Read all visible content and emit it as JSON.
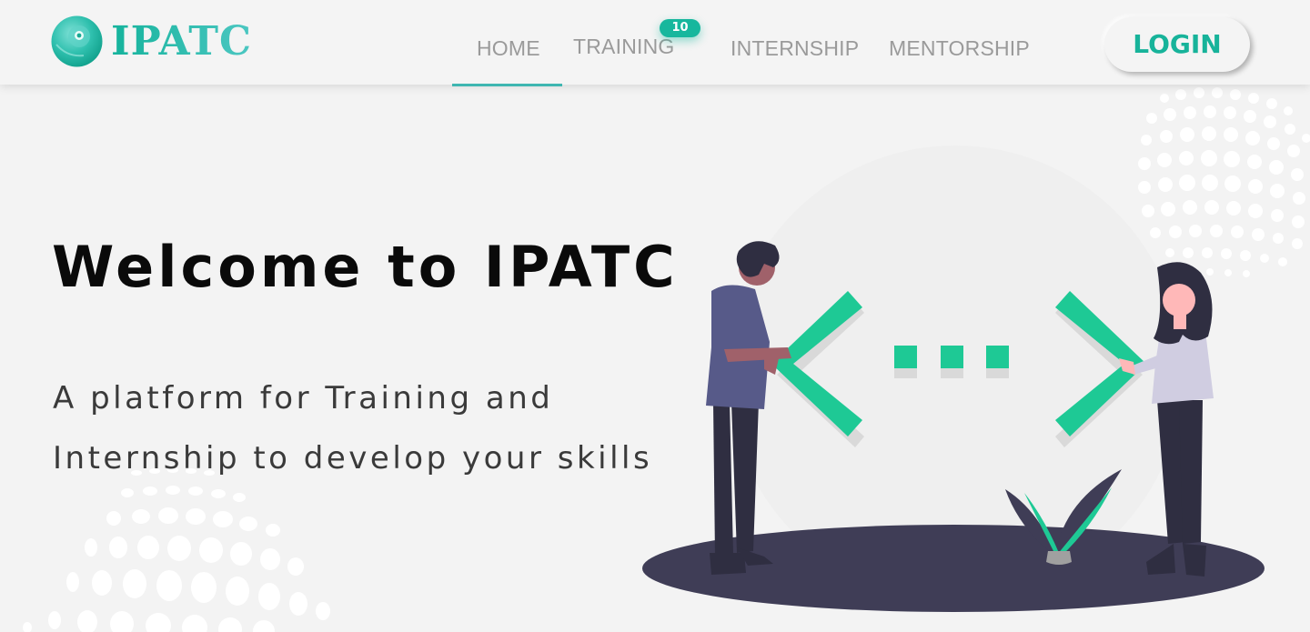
{
  "header": {
    "logo_text": "IPATC",
    "nav": {
      "home": "HOME",
      "training": "TRAINING",
      "internship": "INTERNSHIP",
      "mentorship": "MENTORSHIP"
    },
    "training_badge": "10",
    "active_nav": "HOME",
    "login_label": "LOGIN"
  },
  "hero": {
    "title": "Welcome to IPATC",
    "subtitle_line1": "A platform for Training and",
    "subtitle_line2": "Internship to develop your skills"
  },
  "colors": {
    "accent": "#17b79d",
    "brand_gradient_start": "#15b39c",
    "brand_gradient_end": "#4cc7c2",
    "illustration_green": "#1ec995",
    "illustration_dark": "#3f3d56",
    "page_background": "#f3f3f3"
  },
  "icons": {
    "logo_mark": "teal-sphere-logo-icon",
    "illustration": "people-with-code-brackets-illustration"
  }
}
